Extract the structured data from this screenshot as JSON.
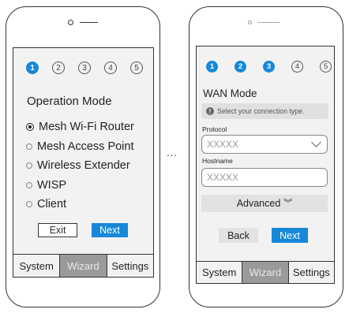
{
  "left_phone": {
    "steps": [
      "1",
      "2",
      "3",
      "4",
      "5"
    ],
    "title": "Operation Mode",
    "modes": [
      "Mesh Wi-Fi Router",
      "Mesh Access Point",
      "Wireless Extender",
      "WISP",
      "Client"
    ],
    "selected_mode": "Mesh Wi-Fi Router",
    "exit_label": "Exit",
    "next_label": "Next",
    "tabs": [
      "System",
      "Wizard",
      "Settings"
    ],
    "active_tab": "Wizard"
  },
  "separator": "...",
  "right_phone": {
    "steps": [
      "1",
      "2",
      "3",
      "4",
      "5"
    ],
    "completed_steps": 3,
    "title": "WAN Mode",
    "info_text": "Select your connection type.",
    "protocol_label": "Protocol",
    "protocol_placeholder": "XXXXX",
    "hostname_label": "Hostname",
    "hostname_placeholder": "XXXXX",
    "advanced_label": "Advanced",
    "back_label": "Back",
    "next_label": "Next",
    "tabs": [
      "System",
      "Wizard",
      "Settings"
    ],
    "active_tab": "Wizard"
  },
  "colors": {
    "accent": "#1788d8",
    "active_tab": "#9a9a9a",
    "screen_bg": "#f2f2f2"
  },
  "icons": [
    "camera-icon",
    "speaker-icon",
    "info-icon",
    "chevron-down-icon",
    "double-chevron-down-icon"
  ]
}
